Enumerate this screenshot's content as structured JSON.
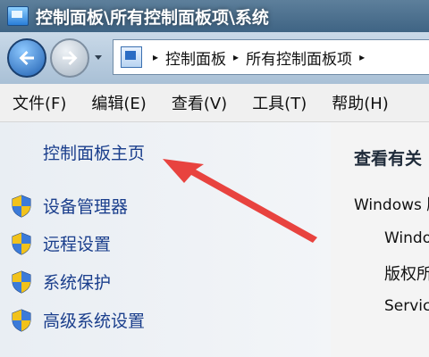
{
  "window": {
    "title": "控制面板\\所有控制面板项\\系统",
    "icon": "control-panel-icon"
  },
  "address_bar": {
    "crumbs": [
      "控制面板",
      "所有控制面板项"
    ],
    "crumb_separator": "▸"
  },
  "menu": {
    "items": [
      "文件(F)",
      "编辑(E)",
      "查看(V)",
      "工具(T)",
      "帮助(H)"
    ]
  },
  "left_pane": {
    "home_link": "控制面板主页",
    "tasks": [
      {
        "label": "设备管理器",
        "icon": "uac-shield-icon"
      },
      {
        "label": "远程设置",
        "icon": "uac-shield-icon"
      },
      {
        "label": "系统保护",
        "icon": "uac-shield-icon"
      },
      {
        "label": "高级系统设置",
        "icon": "uac-shield-icon"
      }
    ]
  },
  "right_pane": {
    "heading": "查看有关",
    "line1": "Windows 版",
    "line2": "Windo",
    "line3": "版权所",
    "line4": "Servic"
  },
  "colors": {
    "link": "#1a3e8c",
    "annotation_arrow": "#e8433f"
  }
}
